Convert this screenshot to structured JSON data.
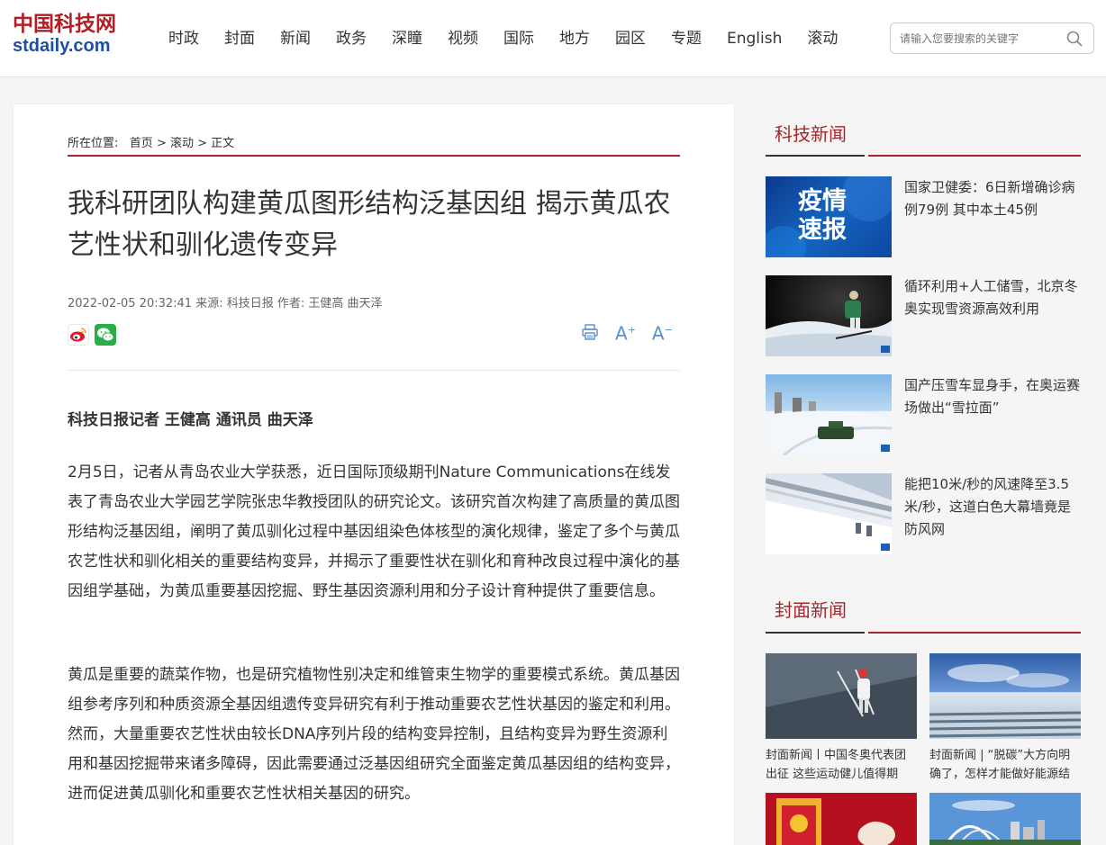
{
  "header": {
    "logo_cn": "中国科技网",
    "logo_en": "stdaily.com",
    "nav": [
      "时政",
      "封面",
      "新闻",
      "政务",
      "深瞳",
      "视频",
      "国际",
      "地方",
      "园区",
      "专题",
      "English",
      "滚动"
    ],
    "search_placeholder": "请输入您要搜索的关键字"
  },
  "article": {
    "breadcrumb_prefix": "所在位置:",
    "breadcrumb": [
      "首页",
      "滚动",
      "正文"
    ],
    "title": "我科研团队构建黄瓜图形结构泛基因组 揭示黄瓜农艺性状和驯化遗传变异",
    "meta": "2022-02-05 20:32:41 来源: 科技日报 作者: 王健高 曲天泽",
    "tools": {
      "print": "print-icon",
      "font_up": "A",
      "font_down": "A"
    },
    "byline": "科技日报记者 王健高 通讯员 曲天泽",
    "paragraphs": [
      "2月5日，记者从青岛农业大学获悉，近日国际顶级期刊Nature Communications在线发表了青岛农业大学园艺学院张忠华教授团队的研究论文。该研究首次构建了高质量的黄瓜图形结构泛基因组，阐明了黄瓜驯化过程中基因组染色体核型的演化规律，鉴定了多个与黄瓜农艺性状和驯化相关的重要结构变异，并揭示了重要性状在驯化和育种改良过程中演化的基因组学基础，为黄瓜重要基因挖掘、野生基因资源利用和分子设计育种提供了重要信息。",
      "黄瓜是重要的蔬菜作物，也是研究植物性别决定和维管束生物学的重要模式系统。黄瓜基因组参考序列和种质资源全基因组遗传变异研究有利于推动重要农艺性状基因的鉴定和利用。然而，大量重要农艺性状由较长DNA序列片段的结构变异控制，且结构变异为野生资源利用和基因挖掘带来诸多障碍，因此需要通过泛基因组研究全面鉴定黄瓜基因组的结构变异，进而促进黄瓜驯化和重要农艺性状相关基因的研究。"
    ]
  },
  "sidebar": {
    "tech_news_title": "科技新闻",
    "tech_news": [
      {
        "text": "国家卫健委：6日新增确诊病例79例 其中本土45例",
        "thumb_text": "疫情速报"
      },
      {
        "text": "循环利用+人工储雪，北京冬奥实现雪资源高效利用"
      },
      {
        "text": "国产压雪车显身手，在奥运赛场做出“雪拉面”"
      },
      {
        "text": "能把10米/秒的风速降至3.5米/秒，这道白色大幕墙竟是防风网"
      }
    ],
    "cover_news_title": "封面新闻",
    "cover_news": [
      {
        "text": "封面新闻丨中国冬奥代表团出征 这些运动健儿值得期"
      },
      {
        "text": "封面新闻 | “脱碳”大方向明确了，怎样才能做好能源结"
      }
    ]
  }
}
